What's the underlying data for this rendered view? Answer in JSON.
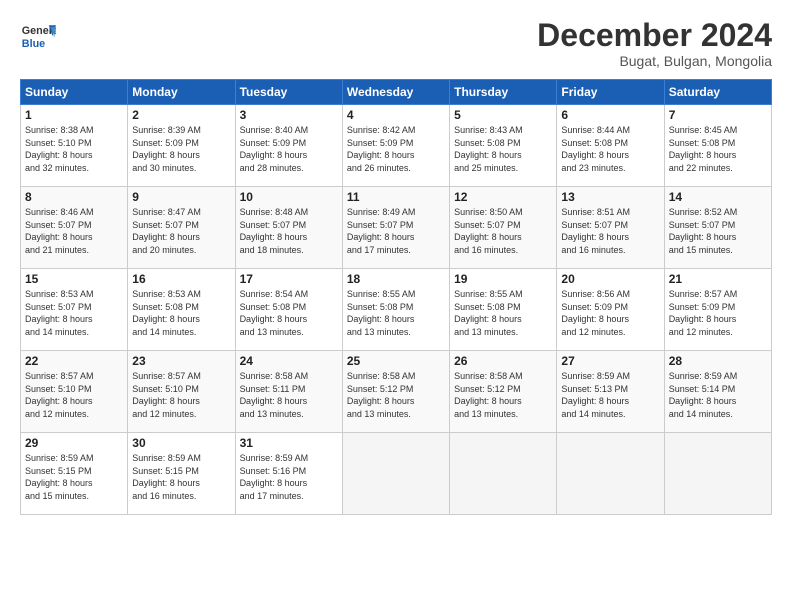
{
  "header": {
    "logo_general": "General",
    "logo_blue": "Blue",
    "month": "December 2024",
    "location": "Bugat, Bulgan, Mongolia"
  },
  "days_of_week": [
    "Sunday",
    "Monday",
    "Tuesday",
    "Wednesday",
    "Thursday",
    "Friday",
    "Saturday"
  ],
  "weeks": [
    [
      {
        "day": "1",
        "text": "Sunrise: 8:38 AM\nSunset: 5:10 PM\nDaylight: 8 hours\nand 32 minutes."
      },
      {
        "day": "2",
        "text": "Sunrise: 8:39 AM\nSunset: 5:09 PM\nDaylight: 8 hours\nand 30 minutes."
      },
      {
        "day": "3",
        "text": "Sunrise: 8:40 AM\nSunset: 5:09 PM\nDaylight: 8 hours\nand 28 minutes."
      },
      {
        "day": "4",
        "text": "Sunrise: 8:42 AM\nSunset: 5:09 PM\nDaylight: 8 hours\nand 26 minutes."
      },
      {
        "day": "5",
        "text": "Sunrise: 8:43 AM\nSunset: 5:08 PM\nDaylight: 8 hours\nand 25 minutes."
      },
      {
        "day": "6",
        "text": "Sunrise: 8:44 AM\nSunset: 5:08 PM\nDaylight: 8 hours\nand 23 minutes."
      },
      {
        "day": "7",
        "text": "Sunrise: 8:45 AM\nSunset: 5:08 PM\nDaylight: 8 hours\nand 22 minutes."
      }
    ],
    [
      {
        "day": "8",
        "text": "Sunrise: 8:46 AM\nSunset: 5:07 PM\nDaylight: 8 hours\nand 21 minutes."
      },
      {
        "day": "9",
        "text": "Sunrise: 8:47 AM\nSunset: 5:07 PM\nDaylight: 8 hours\nand 20 minutes."
      },
      {
        "day": "10",
        "text": "Sunrise: 8:48 AM\nSunset: 5:07 PM\nDaylight: 8 hours\nand 18 minutes."
      },
      {
        "day": "11",
        "text": "Sunrise: 8:49 AM\nSunset: 5:07 PM\nDaylight: 8 hours\nand 17 minutes."
      },
      {
        "day": "12",
        "text": "Sunrise: 8:50 AM\nSunset: 5:07 PM\nDaylight: 8 hours\nand 16 minutes."
      },
      {
        "day": "13",
        "text": "Sunrise: 8:51 AM\nSunset: 5:07 PM\nDaylight: 8 hours\nand 16 minutes."
      },
      {
        "day": "14",
        "text": "Sunrise: 8:52 AM\nSunset: 5:07 PM\nDaylight: 8 hours\nand 15 minutes."
      }
    ],
    [
      {
        "day": "15",
        "text": "Sunrise: 8:53 AM\nSunset: 5:07 PM\nDaylight: 8 hours\nand 14 minutes."
      },
      {
        "day": "16",
        "text": "Sunrise: 8:53 AM\nSunset: 5:08 PM\nDaylight: 8 hours\nand 14 minutes."
      },
      {
        "day": "17",
        "text": "Sunrise: 8:54 AM\nSunset: 5:08 PM\nDaylight: 8 hours\nand 13 minutes."
      },
      {
        "day": "18",
        "text": "Sunrise: 8:55 AM\nSunset: 5:08 PM\nDaylight: 8 hours\nand 13 minutes."
      },
      {
        "day": "19",
        "text": "Sunrise: 8:55 AM\nSunset: 5:08 PM\nDaylight: 8 hours\nand 13 minutes."
      },
      {
        "day": "20",
        "text": "Sunrise: 8:56 AM\nSunset: 5:09 PM\nDaylight: 8 hours\nand 12 minutes."
      },
      {
        "day": "21",
        "text": "Sunrise: 8:57 AM\nSunset: 5:09 PM\nDaylight: 8 hours\nand 12 minutes."
      }
    ],
    [
      {
        "day": "22",
        "text": "Sunrise: 8:57 AM\nSunset: 5:10 PM\nDaylight: 8 hours\nand 12 minutes."
      },
      {
        "day": "23",
        "text": "Sunrise: 8:57 AM\nSunset: 5:10 PM\nDaylight: 8 hours\nand 12 minutes."
      },
      {
        "day": "24",
        "text": "Sunrise: 8:58 AM\nSunset: 5:11 PM\nDaylight: 8 hours\nand 13 minutes."
      },
      {
        "day": "25",
        "text": "Sunrise: 8:58 AM\nSunset: 5:12 PM\nDaylight: 8 hours\nand 13 minutes."
      },
      {
        "day": "26",
        "text": "Sunrise: 8:58 AM\nSunset: 5:12 PM\nDaylight: 8 hours\nand 13 minutes."
      },
      {
        "day": "27",
        "text": "Sunrise: 8:59 AM\nSunset: 5:13 PM\nDaylight: 8 hours\nand 14 minutes."
      },
      {
        "day": "28",
        "text": "Sunrise: 8:59 AM\nSunset: 5:14 PM\nDaylight: 8 hours\nand 14 minutes."
      }
    ],
    [
      {
        "day": "29",
        "text": "Sunrise: 8:59 AM\nSunset: 5:15 PM\nDaylight: 8 hours\nand 15 minutes."
      },
      {
        "day": "30",
        "text": "Sunrise: 8:59 AM\nSunset: 5:15 PM\nDaylight: 8 hours\nand 16 minutes."
      },
      {
        "day": "31",
        "text": "Sunrise: 8:59 AM\nSunset: 5:16 PM\nDaylight: 8 hours\nand 17 minutes."
      },
      null,
      null,
      null,
      null
    ]
  ]
}
